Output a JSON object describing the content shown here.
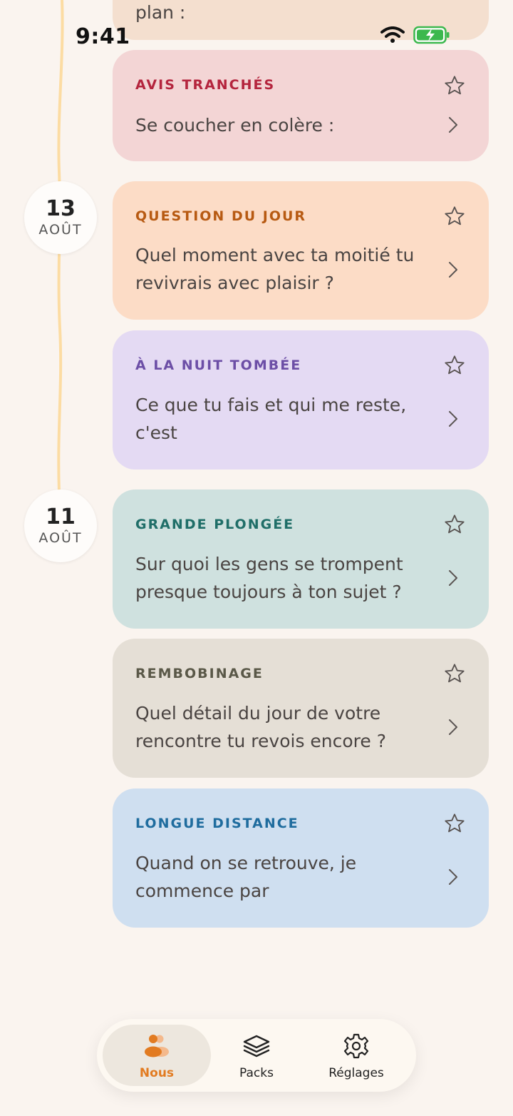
{
  "status_bar": {
    "time": "9:41",
    "icons": [
      "wifi-icon",
      "battery-charging-icon"
    ]
  },
  "colors": {
    "background": "#faf4ef",
    "timeline": "#fcdca3",
    "accent": "#e27b21"
  },
  "partial_card": {
    "text": "plan :"
  },
  "dates": [
    {
      "day": "13",
      "month": "AOÛT"
    },
    {
      "day": "11",
      "month": "AOÛT"
    }
  ],
  "cards": [
    {
      "category": "AVIS TRANCHÉS",
      "question": "Se coucher en colère :",
      "bg": "#f3d5d5",
      "cat_color": "#b4243d"
    },
    {
      "category": "QUESTION DU JOUR",
      "question": "Quel moment avec ta moitié tu revivrais avec plaisir ?",
      "bg": "#fcdcc6",
      "cat_color": "#b75a12"
    },
    {
      "category": "À LA NUIT TOMBÉE",
      "question": "Ce que tu fais et qui me reste, c'est",
      "bg": "#e4daf3",
      "cat_color": "#6c4ea6"
    },
    {
      "category": "GRANDE PLONGÉE",
      "question": "Sur quoi les gens se trompent presque toujours à ton sujet ?",
      "bg": "#cfe1df",
      "cat_color": "#1f6e68"
    },
    {
      "category": "REMBOBINAGE",
      "question": "Quel détail du jour de votre rencontre tu revois encore ?",
      "bg": "#e5dfd6",
      "cat_color": "#5a5848"
    },
    {
      "category": "LONGUE DISTANCE",
      "question": "Quand on se retrouve, je commence par",
      "bg": "#cfdff0",
      "cat_color": "#1f6c9e"
    }
  ],
  "tabbar": {
    "tabs": [
      {
        "label": "Nous",
        "icon": "couple-icon",
        "active": true
      },
      {
        "label": "Packs",
        "icon": "layers-icon",
        "active": false
      },
      {
        "label": "Réglages",
        "icon": "gear-icon",
        "active": false
      }
    ]
  }
}
